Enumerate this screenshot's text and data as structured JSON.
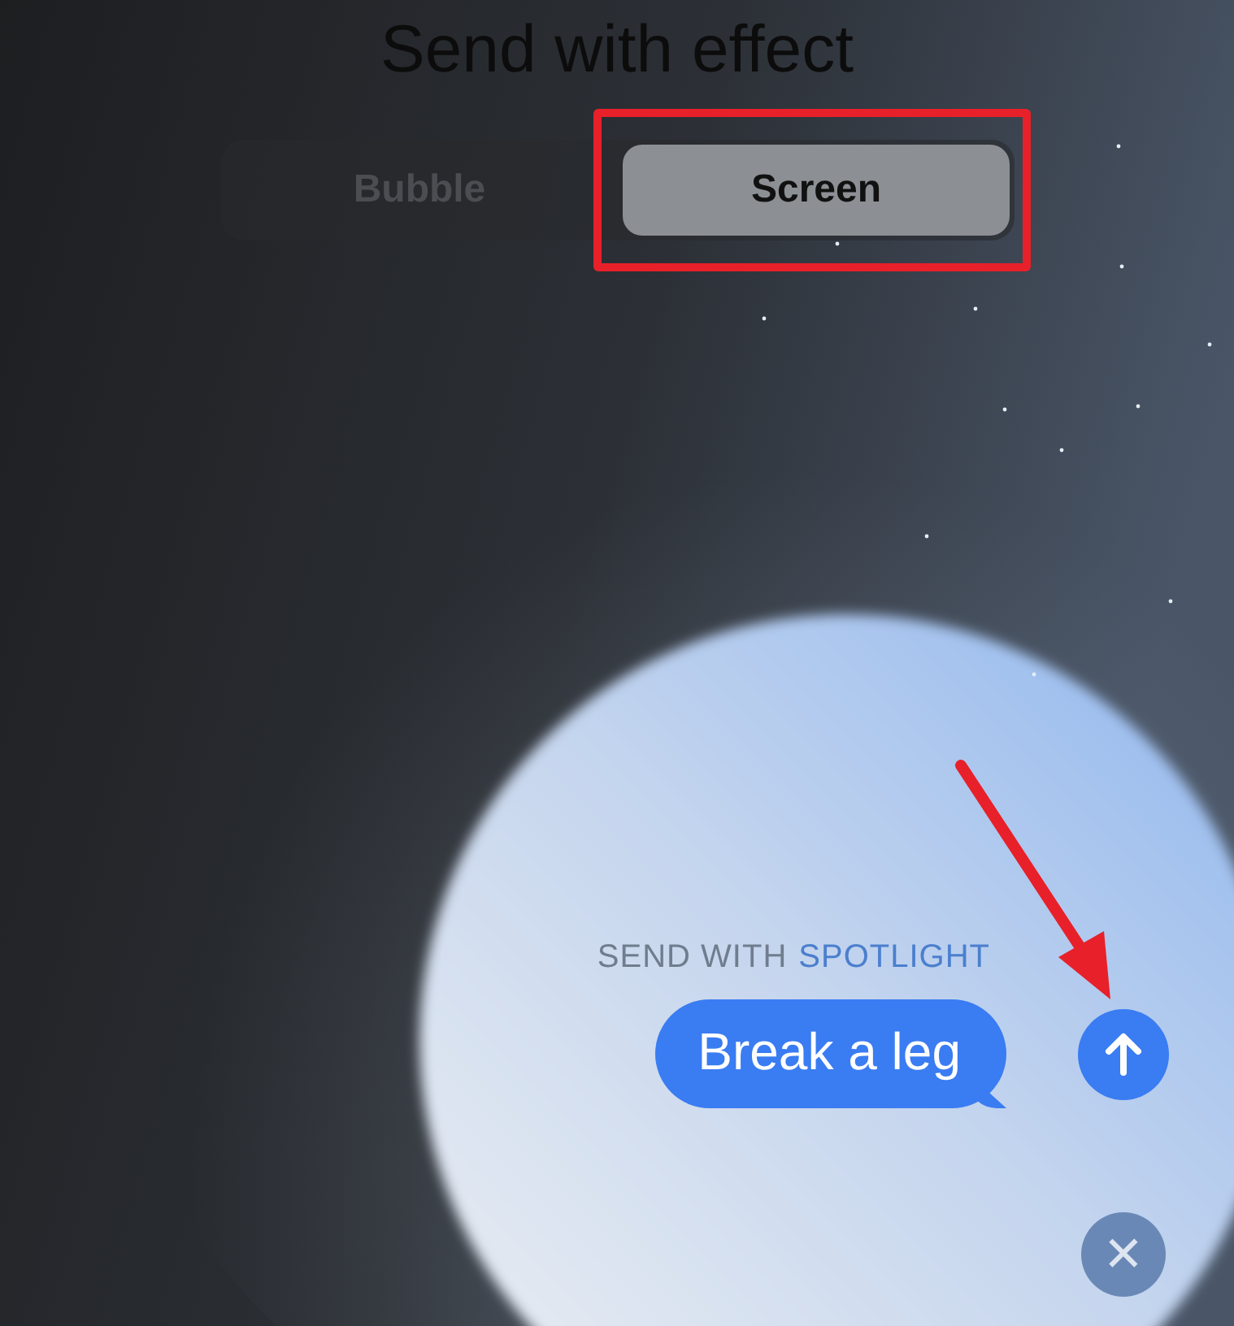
{
  "title": "Send with effect",
  "tabs": [
    {
      "label": "Bubble",
      "selected": false,
      "annotated": false
    },
    {
      "label": "Screen",
      "selected": true,
      "annotated": true
    }
  ],
  "effect_label": {
    "prefix": "SEND WITH",
    "effect": "SPOTLIGHT"
  },
  "message": {
    "text": "Break a leg"
  },
  "send_button": {
    "annotated": true
  },
  "close_button": {
    "label": "✕"
  }
}
